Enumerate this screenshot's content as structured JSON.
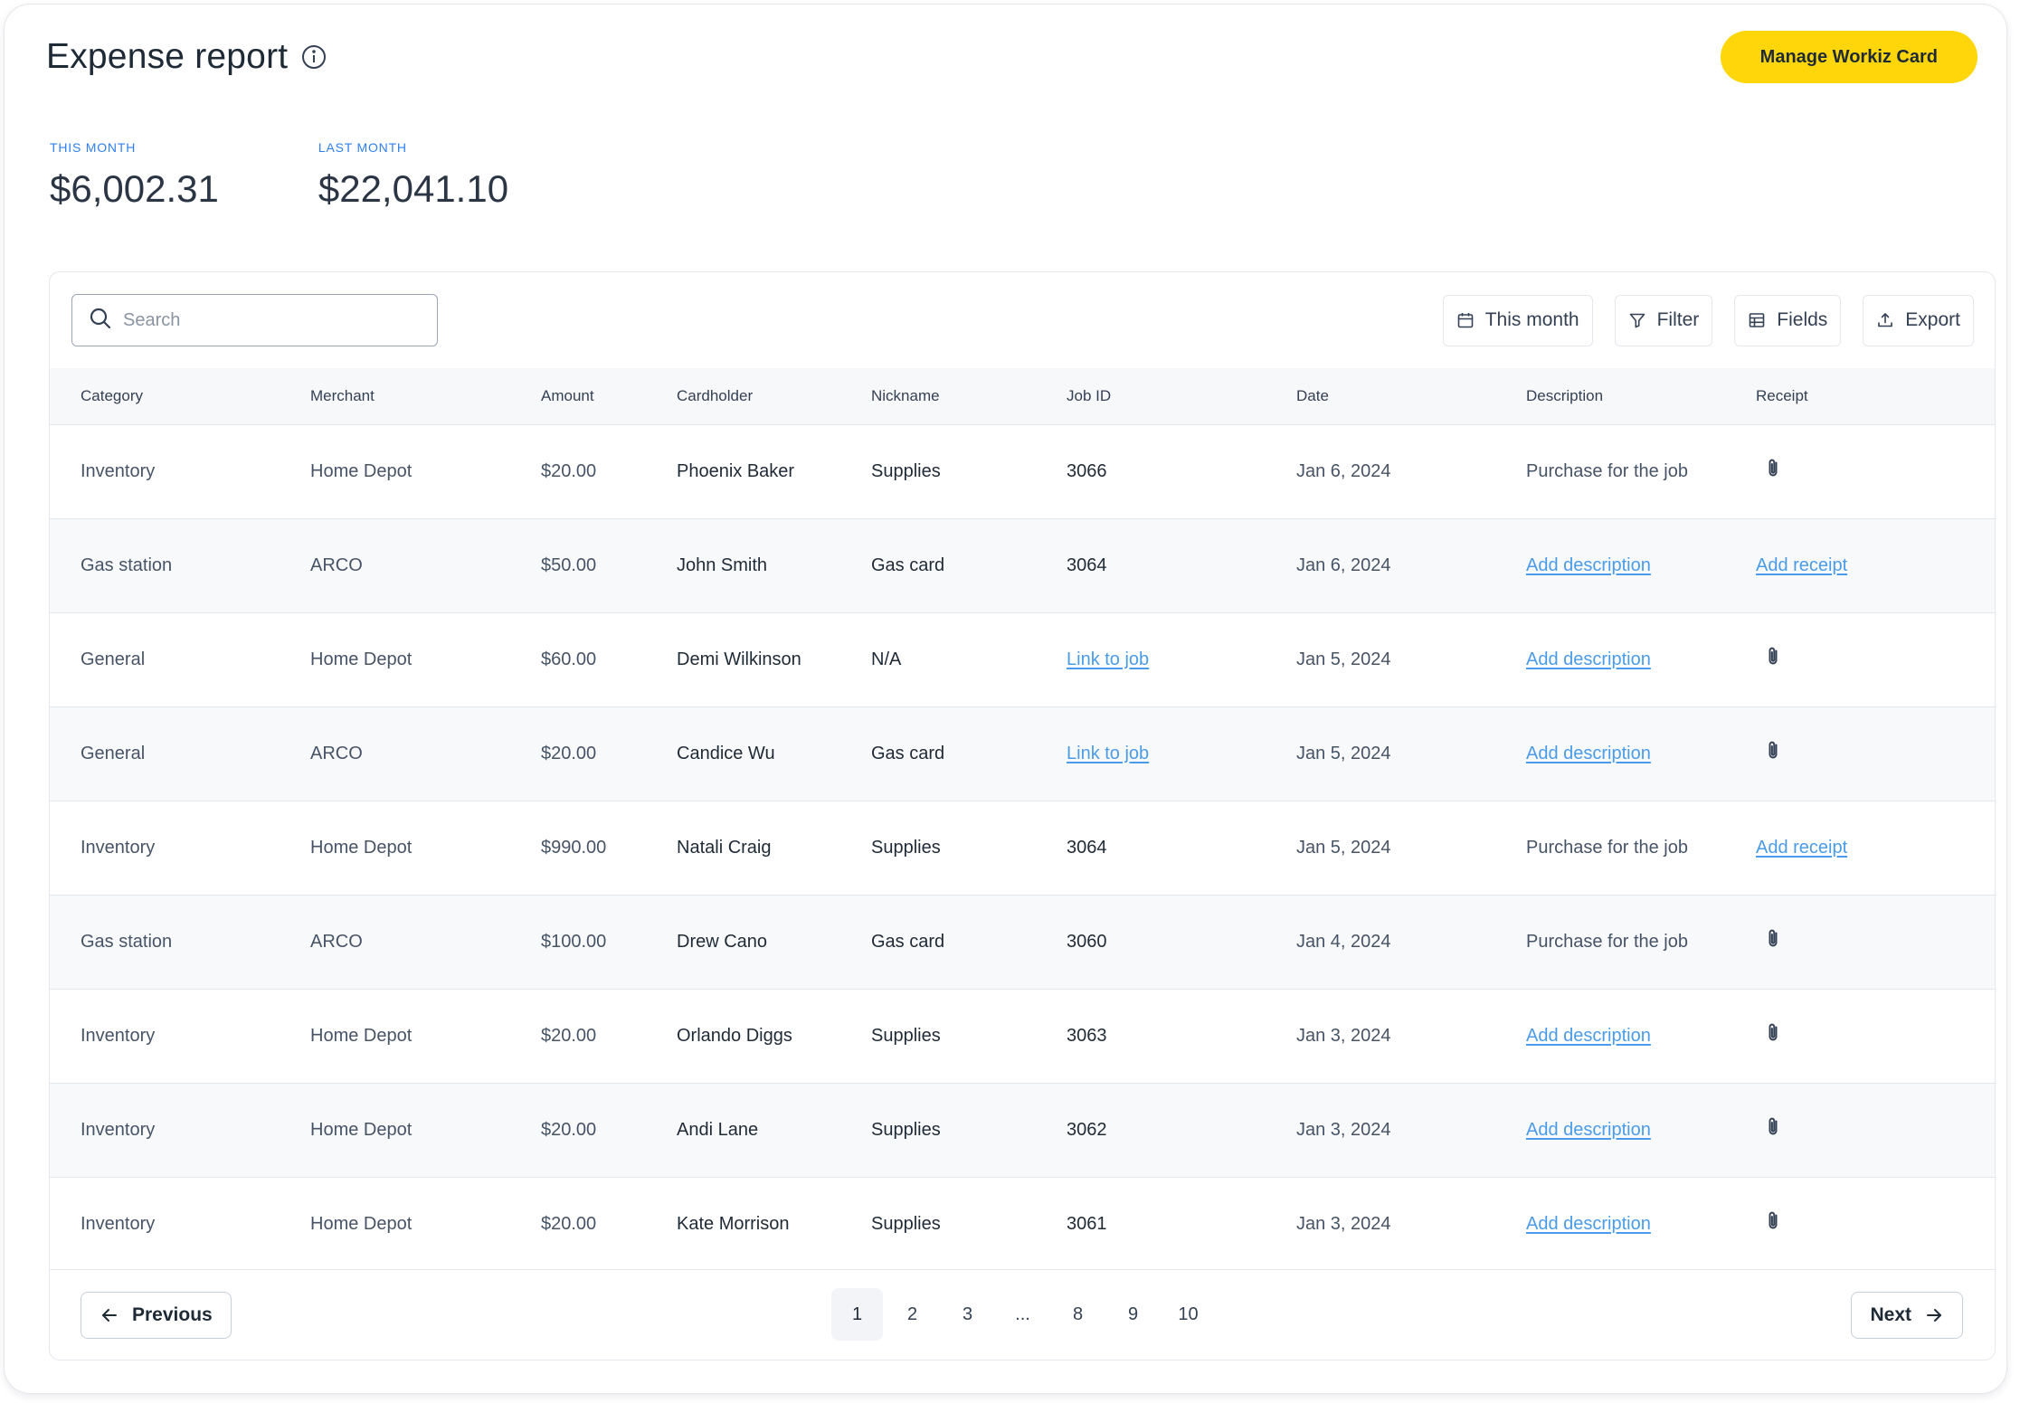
{
  "header": {
    "title": "Expense report",
    "info_icon": "info-icon",
    "manage_button": "Manage Workiz Card"
  },
  "stats": {
    "this_month_label": "THIS MONTH",
    "this_month_value": "$6,002.31",
    "last_month_label": "LAST MONTH",
    "last_month_value": "$22,041.10"
  },
  "toolbar": {
    "search_placeholder": "Search",
    "search_value": "",
    "date_range": "This month",
    "filter": "Filter",
    "fields": "Fields",
    "export": "Export"
  },
  "table": {
    "columns": [
      "Category",
      "Merchant",
      "Amount",
      "Cardholder",
      "Nickname",
      "Job ID",
      "Date",
      "Description",
      "Receipt"
    ],
    "rows": [
      {
        "category": "Inventory",
        "merchant": "Home Depot",
        "amount": "$20.00",
        "cardholder": "Phoenix Baker",
        "nickname": "Supplies",
        "job_id": "3066",
        "job_link": false,
        "date": "Jan 6, 2024",
        "description": "Purchase for the job",
        "description_link": false,
        "receipt": "paperclip-icon",
        "receipt_link": false
      },
      {
        "category": "Gas station",
        "merchant": "ARCO",
        "amount": "$50.00",
        "cardholder": "John Smith",
        "nickname": "Gas card",
        "job_id": "3064",
        "job_link": false,
        "date": "Jan 6, 2024",
        "description": "Add description",
        "description_link": true,
        "receipt": "Add receipt",
        "receipt_link": true
      },
      {
        "category": "General",
        "merchant": "Home Depot",
        "amount": "$60.00",
        "cardholder": "Demi Wilkinson",
        "nickname": "N/A",
        "job_id": "Link to job",
        "job_link": true,
        "date": "Jan 5, 2024",
        "description": "Add description",
        "description_link": true,
        "receipt": "paperclip-icon",
        "receipt_link": false
      },
      {
        "category": "General",
        "merchant": "ARCO",
        "amount": "$20.00",
        "cardholder": "Candice Wu",
        "nickname": "Gas card",
        "job_id": "Link to job",
        "job_link": true,
        "date": "Jan 5, 2024",
        "description": "Add description",
        "description_link": true,
        "receipt": "paperclip-icon",
        "receipt_link": false
      },
      {
        "category": "Inventory",
        "merchant": "Home Depot",
        "amount": "$990.00",
        "cardholder": "Natali Craig",
        "nickname": "Supplies",
        "job_id": "3064",
        "job_link": false,
        "date": "Jan 5, 2024",
        "description": "Purchase for the job",
        "description_link": false,
        "receipt": "Add receipt",
        "receipt_link": true
      },
      {
        "category": "Gas station",
        "merchant": "ARCO",
        "amount": "$100.00",
        "cardholder": "Drew Cano",
        "nickname": "Gas card",
        "job_id": "3060",
        "job_link": false,
        "date": "Jan 4, 2024",
        "description": "Purchase for the job",
        "description_link": false,
        "receipt": "paperclip-icon",
        "receipt_link": false
      },
      {
        "category": "Inventory",
        "merchant": "Home Depot",
        "amount": "$20.00",
        "cardholder": "Orlando Diggs",
        "nickname": "Supplies",
        "job_id": "3063",
        "job_link": false,
        "date": "Jan 3, 2024",
        "description": "Add description",
        "description_link": true,
        "receipt": "paperclip-icon",
        "receipt_link": false
      },
      {
        "category": "Inventory",
        "merchant": "Home Depot",
        "amount": "$20.00",
        "cardholder": "Andi Lane",
        "nickname": "Supplies",
        "job_id": "3062",
        "job_link": false,
        "date": "Jan 3, 2024",
        "description": "Add description",
        "description_link": true,
        "receipt": "paperclip-icon",
        "receipt_link": false
      },
      {
        "category": "Inventory",
        "merchant": "Home Depot",
        "amount": "$20.00",
        "cardholder": "Kate Morrison",
        "nickname": "Supplies",
        "job_id": "3061",
        "job_link": false,
        "date": "Jan 3, 2024",
        "description": "Add description",
        "description_link": true,
        "receipt": "paperclip-icon",
        "receipt_link": false
      }
    ]
  },
  "pagination": {
    "previous": "Previous",
    "next": "Next",
    "pages": [
      "1",
      "2",
      "3",
      "...",
      "8",
      "9",
      "10"
    ],
    "current": "1"
  },
  "colors": {
    "accent": "#ffd60a",
    "link": "#4a9be8",
    "stat_label": "#2f80ed"
  }
}
